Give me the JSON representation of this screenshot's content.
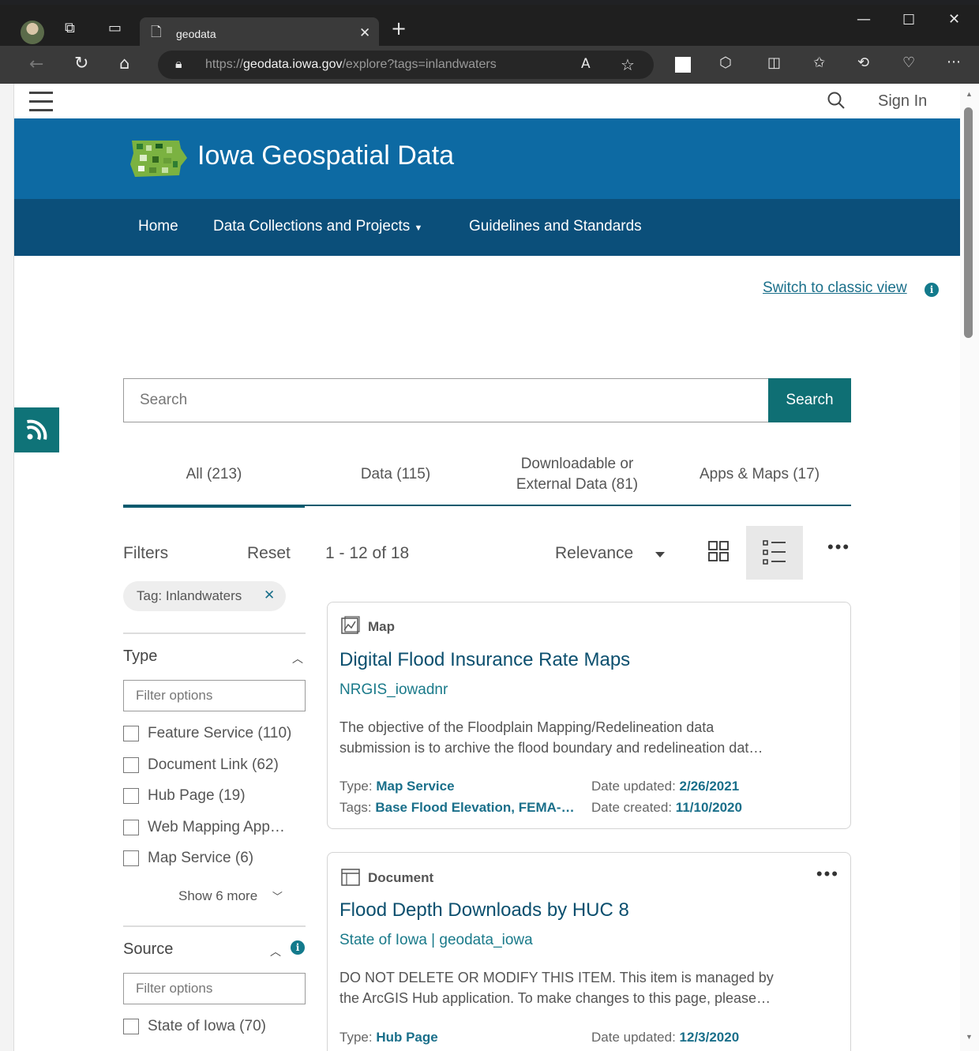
{
  "browser": {
    "tab_title": "geodata",
    "url_prefix": "https://",
    "url_host": "geodata.iowa.gov",
    "url_path": "/explore?tags=inlandwaters"
  },
  "header": {
    "signin": "Sign In",
    "site_title": "Iowa Geospatial Data",
    "nav": [
      "Home",
      "Data Collections and Projects",
      "Guidelines and Standards"
    ]
  },
  "classic_view_link": "Switch to classic view",
  "search": {
    "placeholder": "Search",
    "button": "Search"
  },
  "tabs": [
    {
      "label": "All (213)",
      "active": true
    },
    {
      "label": "Data (115)",
      "active": false
    },
    {
      "label_line1": "Downloadable or",
      "label_line2": "External Data (81)",
      "active": false
    },
    {
      "label": "Apps & Maps (17)",
      "active": false
    }
  ],
  "toolbar": {
    "filters": "Filters",
    "reset": "Reset",
    "result_count": "1 - 12 of 18",
    "sort": "Relevance"
  },
  "active_filter_chip": "Tag: Inlandwaters",
  "facets": {
    "type": {
      "title": "Type",
      "placeholder": "Filter options",
      "options": [
        "Feature Service (110)",
        "Document Link (62)",
        "Hub Page (19)",
        "Web Mapping App…",
        "Map Service (6)"
      ],
      "show_more": "Show 6 more"
    },
    "source": {
      "title": "Source",
      "placeholder": "Filter options",
      "options": [
        "State of Iowa (70)"
      ]
    }
  },
  "results": [
    {
      "type": "Map",
      "title": "Digital Flood Insurance Rate Maps",
      "owner": "NRGIS_iowadnr",
      "desc_line1": "The objective of the Floodplain Mapping/Redelineation data",
      "desc_line2": "submission is to archive the flood boundary and redelineation dat…",
      "meta_type_label": "Type:",
      "meta_type": "Map Service",
      "meta_tags_label": "Tags:",
      "meta_tags": "Base Flood Elevation, FEMA-…",
      "updated_label": "Date updated:",
      "updated": "2/26/2021",
      "created_label": "Date created:",
      "created": "11/10/2020"
    },
    {
      "type": "Document",
      "title": "Flood Depth Downloads by HUC 8",
      "owner": "State of Iowa | geodata_iowa",
      "desc_line1": "DO NOT DELETE OR MODIFY THIS ITEM. This item is managed by",
      "desc_line2": "the ArcGIS Hub application. To make changes to this page, please…",
      "meta_type_label": "Type:",
      "meta_type": "Hub Page",
      "updated_label": "Date updated:",
      "updated": "12/3/2020"
    }
  ],
  "colors": {
    "banner": "#0d6aa3",
    "navbar": "#0b4f7a",
    "accent": "#0f6f74",
    "link": "#1a6f8a"
  }
}
